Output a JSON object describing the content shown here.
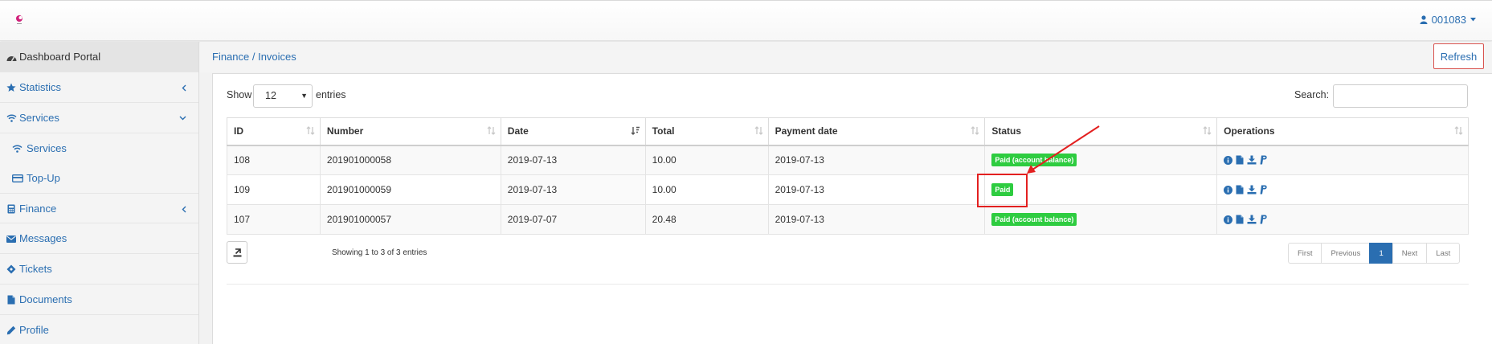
{
  "header": {
    "user_label": "001083"
  },
  "sidebar": {
    "items": [
      {
        "label": "Dashboard Portal",
        "icon": "dashboard-icon"
      },
      {
        "label": "Statistics",
        "icon": "star-icon"
      },
      {
        "label": "Services",
        "icon": "wifi-icon"
      },
      {
        "label": "Services",
        "icon": "wifi-icon"
      },
      {
        "label": "Top-Up",
        "icon": "card-icon"
      },
      {
        "label": "Finance",
        "icon": "calculator-icon"
      },
      {
        "label": "Messages",
        "icon": "envelope-icon"
      },
      {
        "label": "Tickets",
        "icon": "ticket-icon"
      },
      {
        "label": "Documents",
        "icon": "file-icon"
      },
      {
        "label": "Profile",
        "icon": "pencil-icon"
      }
    ]
  },
  "breadcrumb": {
    "section": "Finance",
    "separator": " / ",
    "page": "Invoices"
  },
  "toolbar": {
    "refresh_label": "Refresh"
  },
  "table_controls": {
    "show_label": "Show",
    "page_length": "12",
    "entries_label": "entries",
    "search_label": "Search:",
    "search_value": ""
  },
  "table": {
    "columns": [
      "ID",
      "Number",
      "Date",
      "Total",
      "Payment date",
      "Status",
      "Operations"
    ],
    "rows": [
      {
        "id": "108",
        "number": "201901000058",
        "date": "2019-07-13",
        "total": "10.00",
        "payment_date": "2019-07-13",
        "status": "Paid (account balance)"
      },
      {
        "id": "109",
        "number": "201901000059",
        "date": "2019-07-13",
        "total": "10.00",
        "payment_date": "2019-07-13",
        "status": "Paid"
      },
      {
        "id": "107",
        "number": "201901000057",
        "date": "2019-07-07",
        "total": "20.48",
        "payment_date": "2019-07-13",
        "status": "Paid (account balance)"
      }
    ]
  },
  "footer": {
    "info": "Showing 1 to 3 of 3 entries"
  },
  "pagination": {
    "first": "First",
    "previous": "Previous",
    "current": "1",
    "next": "Next",
    "last": "Last"
  },
  "colors": {
    "accent": "#2a6eb1",
    "status_paid": "#2ecc40",
    "annotation": "#e32020"
  }
}
